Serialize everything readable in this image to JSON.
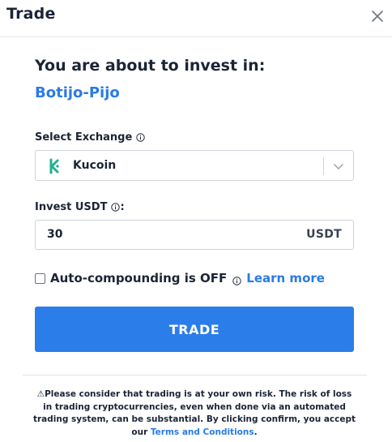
{
  "header": {
    "title": "Trade"
  },
  "intro": {
    "heading": "You are about to invest in:",
    "bot_name": "Botijo-Pijo"
  },
  "exchange": {
    "label": "Select Exchange",
    "selected": "Kucoin",
    "logo_icon": "kucoin-logo",
    "brand_color": "#23AF91"
  },
  "invest": {
    "label": "Invest USDT",
    "label_suffix": ":",
    "value": "30",
    "unit": "USDT"
  },
  "autocompound": {
    "checked": false,
    "label": "Auto-compounding is OFF",
    "learn_more": "Learn more"
  },
  "trade_button": {
    "label": "TRADE",
    "color": "#2B7DE9"
  },
  "disclaimer": {
    "text": "⚠Please consider that trading is at your own risk. The risk of loss in trading cryptocurrencies, even when done via an automated trading system, can be substantial. By clicking confirm, you accept our ",
    "link": "Terms and Conditions",
    "end": "."
  },
  "colors": {
    "accent": "#2A7BE4",
    "text": "#1B2436",
    "border": "#CFD4DC"
  }
}
